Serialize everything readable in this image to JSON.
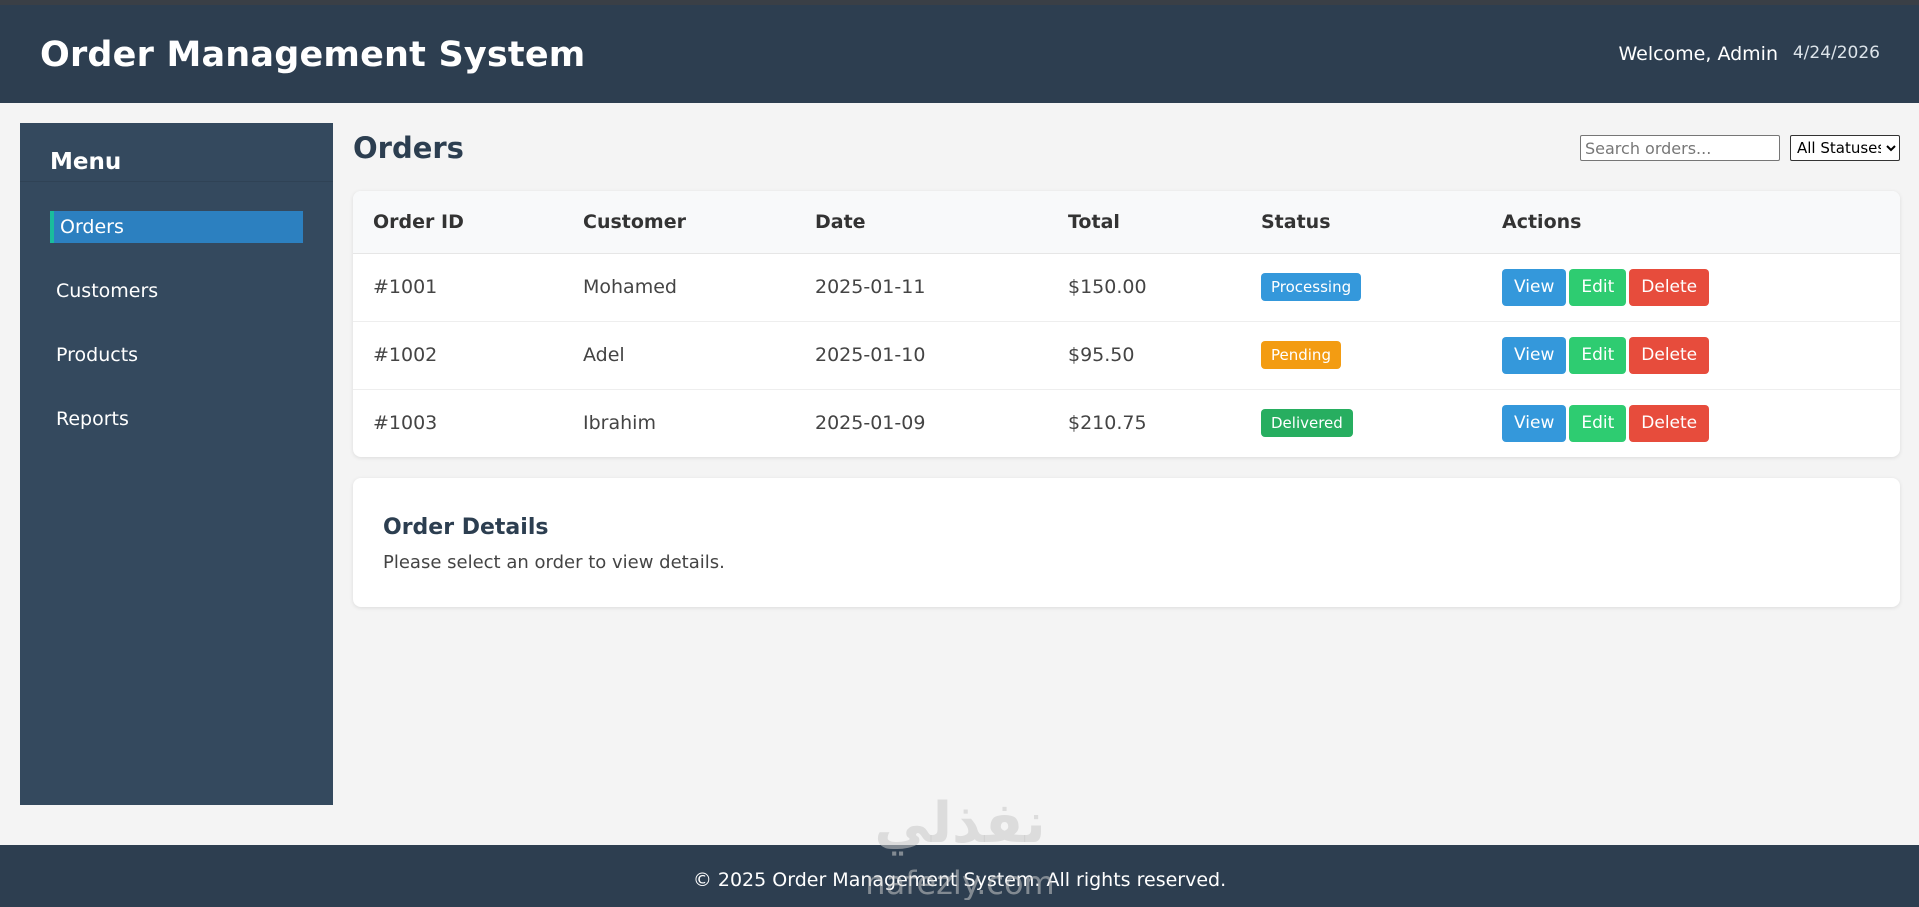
{
  "header": {
    "title": "Order Management System",
    "welcome": "Welcome, Admin",
    "date": "4/24/2026"
  },
  "sidebar": {
    "title": "Menu",
    "items": [
      {
        "label": "Orders",
        "active": true
      },
      {
        "label": "Customers",
        "active": false
      },
      {
        "label": "Products",
        "active": false
      },
      {
        "label": "Reports",
        "active": false
      }
    ]
  },
  "main": {
    "title": "Orders",
    "search_placeholder": "Search orders...",
    "status_filter": "All Statuses",
    "columns": [
      "Order ID",
      "Customer",
      "Date",
      "Total",
      "Status",
      "Actions"
    ],
    "orders": [
      {
        "id": "#1001",
        "customer": "Mohamed",
        "date": "2025-01-11",
        "total": "$150.00",
        "status": "Processing"
      },
      {
        "id": "#1002",
        "customer": "Adel",
        "date": "2025-01-10",
        "total": "$95.50",
        "status": "Pending"
      },
      {
        "id": "#1003",
        "customer": "Ibrahim",
        "date": "2025-01-09",
        "total": "$210.75",
        "status": "Delivered"
      }
    ],
    "actions": {
      "view": "View",
      "edit": "Edit",
      "delete": "Delete"
    },
    "details": {
      "title": "Order Details",
      "message": "Please select an order to view details."
    }
  },
  "footer": {
    "text": "© 2025 Order Management System. All rights reserved."
  },
  "watermark": {
    "arabic": "نفذلي",
    "latin": "nafezly.com"
  },
  "colors": {
    "header_bg": "#2d3e50",
    "sidebar_bg": "#34495e",
    "active_item": "#2c80c0",
    "accent_border": "#1abc9c",
    "processing": "#3498db",
    "pending": "#f39c12",
    "delivered": "#27ae60",
    "view": "#3498db",
    "edit": "#2ecc71",
    "delete": "#e74c3c"
  }
}
